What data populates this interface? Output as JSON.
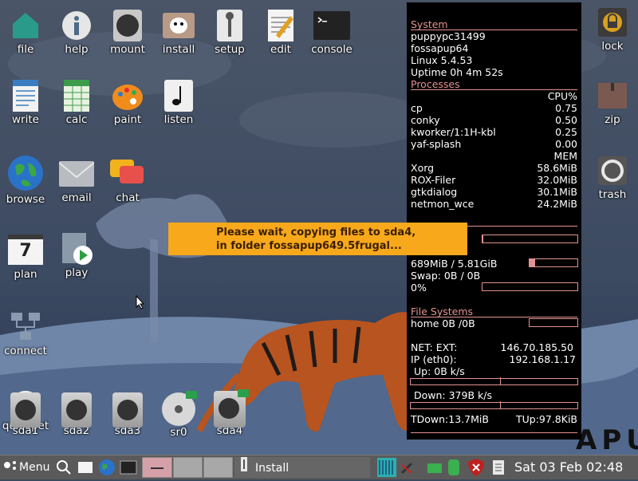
{
  "desktop_icons": [
    {
      "label": "file",
      "icon": "home-folder-icon"
    },
    {
      "label": "help",
      "icon": "info-icon"
    },
    {
      "label": "mount",
      "icon": "drive-icon"
    },
    {
      "label": "install",
      "icon": "puppy-install-icon"
    },
    {
      "label": "setup",
      "icon": "wrench-icon"
    },
    {
      "label": "edit",
      "icon": "text-editor-icon"
    },
    {
      "label": "console",
      "icon": "terminal-icon"
    },
    {
      "label": "lock",
      "icon": "lock-icon"
    },
    {
      "label": "write",
      "icon": "document-icon"
    },
    {
      "label": "calc",
      "icon": "spreadsheet-icon"
    },
    {
      "label": "paint",
      "icon": "palette-icon"
    },
    {
      "label": "listen",
      "icon": "music-note-icon"
    },
    {
      "label": "zip",
      "icon": "archive-icon"
    },
    {
      "label": "browse",
      "icon": "globe-icon"
    },
    {
      "label": "email",
      "icon": "envelope-icon"
    },
    {
      "label": "chat",
      "icon": "chat-bubbles-icon"
    },
    {
      "label": "trash",
      "icon": "trash-icon"
    },
    {
      "label": "plan",
      "icon": "calendar-icon"
    },
    {
      "label": "play",
      "icon": "video-play-icon"
    },
    {
      "label": "connect",
      "icon": "network-icon"
    },
    {
      "label": "quickpet",
      "icon": "puppy-icon"
    }
  ],
  "calendar_day": "7",
  "drives": [
    {
      "label": "sda1"
    },
    {
      "label": "sda2"
    },
    {
      "label": "sda3"
    },
    {
      "label": "sr0"
    },
    {
      "label": "sda4"
    }
  ],
  "conky": {
    "system_header": "System",
    "hostname": "puppypc31499",
    "distro": "fossapup64",
    "kernel": "Linux 5.4.53",
    "uptime": "Uptime 0h 4m 52s",
    "processes_header": "Processes",
    "cpu_header": "CPU%",
    "cpu_procs": [
      {
        "name": "cp",
        "value": "0.75"
      },
      {
        "name": "conky",
        "value": "0.50"
      },
      {
        "name": "kworker/1:1H-kbl",
        "value": "0.25"
      },
      {
        "name": "yaf-splash",
        "value": "0.00"
      }
    ],
    "mem_header": "MEM",
    "mem_procs": [
      {
        "name": "Xorg",
        "value": "58.6MiB"
      },
      {
        "name": "ROX-Filer",
        "value": "32.0MiB"
      },
      {
        "name": "gtkdialog",
        "value": "30.1MiB"
      },
      {
        "name": "netmon_wce",
        "value": "24.2MiB"
      }
    ],
    "ram": "689MiB / 5.81GiB",
    "swap": "Swap: 0B   / 0B",
    "swap_pct": "0%",
    "fs_header": "File Systems",
    "fs_home": "home 0B  /0B",
    "net_ext_label": "NET: EXT:",
    "net_ext_ip": "146.70.185.50",
    "ip_label": "IP (eth0):",
    "ip_value": "192.168.1.17",
    "up": "Up: 0B   k/s",
    "down": "Down: 379B  k/s",
    "tdown": "TDown:13.7MiB",
    "tup": "TUp:97.8KiB",
    "cpu_bar_fraction": 0.01,
    "ram_bar_fraction": 0.12,
    "swap_bar_fraction": 0.0,
    "fs_bar_fraction": 0.0
  },
  "notification": {
    "line1": "Please wait, copying files to sda4,",
    "line2": "in folder fossapup649.5frugal..."
  },
  "wallpaper_text": "APU",
  "taskbar": {
    "menu_label": "Menu",
    "task_label": "Install",
    "clock": "Sat 03 Feb 02:48"
  }
}
